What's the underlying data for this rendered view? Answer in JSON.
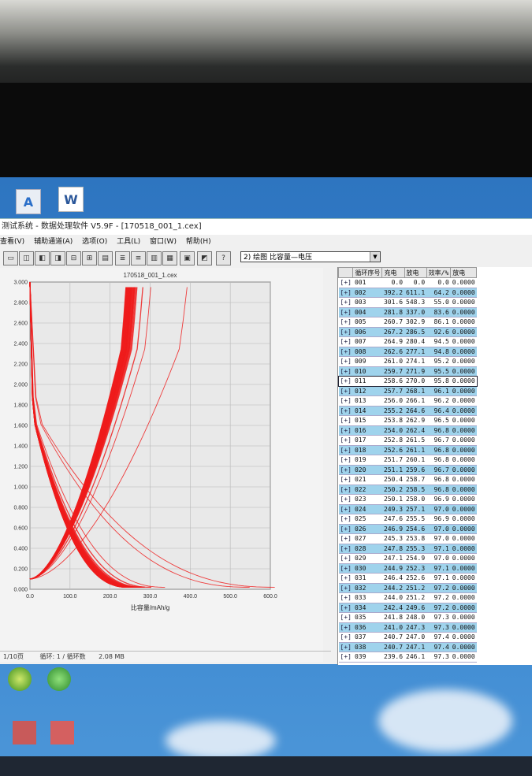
{
  "window": {
    "title": "测试系统 - 数据处理软件 V5.9F - [170518_001_1.cex]",
    "file_title": "170518_001_1.cex",
    "status": [
      "1/10页",
      "循环: 1 / 循环数",
      "2.08 MB"
    ]
  },
  "menu": [
    "查看(V)",
    "辅助通道(A)",
    "选项(O)",
    "工具(L)",
    "窗口(W)",
    "帮助(H)"
  ],
  "combo": {
    "value": "2) 绘图 比容量—电压"
  },
  "desktop_icons": [
    {
      "name": "A",
      "color": "#2a6fc9"
    },
    {
      "name": "W",
      "color": "#2b579a"
    }
  ],
  "chart_data": {
    "type": "line",
    "xlabel": "比容量/mAh/g",
    "x_ticks": [
      "0.0",
      "100.0",
      "200.0",
      "300.0",
      "400.0",
      "500.0",
      "600.0"
    ],
    "y_ticks": [
      "0.000",
      "0.200",
      "0.400",
      "0.600",
      "0.800",
      "1.000",
      "1.200",
      "1.400",
      "1.600",
      "1.800",
      "2.000",
      "2.200",
      "2.400",
      "2.600",
      "2.800",
      "3.000"
    ],
    "xlim": [
      0,
      600
    ],
    "ylim": [
      0,
      3.0
    ],
    "grid": true,
    "series_color": "#ee1c1c",
    "discharge_capacities": [
      611.1,
      548.3,
      337.0,
      302.9,
      286.5,
      280.4,
      277.1,
      274.1,
      271.9,
      270.0,
      268.1,
      266.1,
      264.6,
      262.9,
      262.4,
      261.5,
      261.1,
      260.1,
      259.6,
      258.7,
      258.5,
      258.0,
      257.1,
      255.5,
      254.6,
      253.8,
      255.3,
      254.9,
      252.3,
      252.6,
      251.2,
      251.2,
      249.6,
      248.0,
      247.3,
      247.0,
      247.1,
      246.1
    ],
    "charge_capacities": [
      0.0,
      392.2,
      301.6,
      281.8,
      260.7,
      267.2,
      264.9,
      262.6,
      261.0,
      259.7,
      258.6,
      257.7,
      256.0,
      255.2,
      253.8,
      254.0,
      252.8,
      252.6,
      251.7,
      251.1,
      250.4,
      250.2,
      250.1,
      249.3,
      247.6,
      246.9,
      245.3,
      247.8,
      247.1,
      244.9,
      246.4,
      244.2,
      244.0,
      242.4,
      241.8,
      241.0,
      240.7,
      240.7,
      239.6
    ]
  },
  "table": {
    "headers": [
      "循环序号",
      "充电",
      "放电",
      "效率/%",
      "放电"
    ],
    "rows": [
      [
        "001",
        "0.0",
        "0.0",
        "0.0",
        "0.0000"
      ],
      [
        "002",
        "392.2",
        "611.1",
        "64.2",
        "0.0000"
      ],
      [
        "003",
        "301.6",
        "548.3",
        "55.0",
        "0.0000"
      ],
      [
        "004",
        "281.8",
        "337.0",
        "83.6",
        "0.0000"
      ],
      [
        "005",
        "260.7",
        "302.9",
        "86.1",
        "0.0000"
      ],
      [
        "006",
        "267.2",
        "286.5",
        "92.6",
        "0.0000"
      ],
      [
        "007",
        "264.9",
        "280.4",
        "94.5",
        "0.0000"
      ],
      [
        "008",
        "262.6",
        "277.1",
        "94.8",
        "0.0000"
      ],
      [
        "009",
        "261.0",
        "274.1",
        "95.2",
        "0.0000"
      ],
      [
        "010",
        "259.7",
        "271.9",
        "95.5",
        "0.0000"
      ],
      [
        "011",
        "258.6",
        "270.0",
        "95.8",
        "0.0000"
      ],
      [
        "012",
        "257.7",
        "268.1",
        "96.1",
        "0.0000"
      ],
      [
        "013",
        "256.0",
        "266.1",
        "96.2",
        "0.0000"
      ],
      [
        "014",
        "255.2",
        "264.6",
        "96.4",
        "0.0000"
      ],
      [
        "015",
        "253.8",
        "262.9",
        "96.5",
        "0.0000"
      ],
      [
        "016",
        "254.0",
        "262.4",
        "96.8",
        "0.0000"
      ],
      [
        "017",
        "252.8",
        "261.5",
        "96.7",
        "0.0000"
      ],
      [
        "018",
        "252.6",
        "261.1",
        "96.8",
        "0.0000"
      ],
      [
        "019",
        "251.7",
        "260.1",
        "96.8",
        "0.0000"
      ],
      [
        "020",
        "251.1",
        "259.6",
        "96.7",
        "0.0000"
      ],
      [
        "021",
        "250.4",
        "258.7",
        "96.8",
        "0.0000"
      ],
      [
        "022",
        "250.2",
        "258.5",
        "96.8",
        "0.0000"
      ],
      [
        "023",
        "250.1",
        "258.0",
        "96.9",
        "0.0000"
      ],
      [
        "024",
        "249.3",
        "257.1",
        "97.0",
        "0.0000"
      ],
      [
        "025",
        "247.6",
        "255.5",
        "96.9",
        "0.0000"
      ],
      [
        "026",
        "246.9",
        "254.6",
        "97.0",
        "0.0000"
      ],
      [
        "027",
        "245.3",
        "253.8",
        "97.0",
        "0.0000"
      ],
      [
        "028",
        "247.8",
        "255.3",
        "97.1",
        "0.0000"
      ],
      [
        "029",
        "247.1",
        "254.9",
        "97.0",
        "0.0000"
      ],
      [
        "030",
        "244.9",
        "252.3",
        "97.1",
        "0.0000"
      ],
      [
        "031",
        "246.4",
        "252.6",
        "97.1",
        "0.0000"
      ],
      [
        "032",
        "244.2",
        "251.2",
        "97.2",
        "0.0000"
      ],
      [
        "033",
        "244.0",
        "251.2",
        "97.2",
        "0.0000"
      ],
      [
        "034",
        "242.4",
        "249.6",
        "97.2",
        "0.0000"
      ],
      [
        "035",
        "241.8",
        "248.0",
        "97.3",
        "0.0000"
      ],
      [
        "036",
        "241.0",
        "247.3",
        "97.3",
        "0.0000"
      ],
      [
        "037",
        "240.7",
        "247.0",
        "97.4",
        "0.0000"
      ],
      [
        "038",
        "240.7",
        "247.1",
        "97.4",
        "0.0000"
      ],
      [
        "039",
        "239.6",
        "246.1",
        "97.3",
        "0.0000"
      ]
    ],
    "highlight_rows": [
      "002",
      "004",
      "006",
      "008",
      "010",
      "012",
      "014",
      "016",
      "018",
      "020",
      "022",
      "024",
      "026",
      "028",
      "030",
      "032",
      "034",
      "036",
      "038"
    ],
    "selected_row": "011"
  }
}
